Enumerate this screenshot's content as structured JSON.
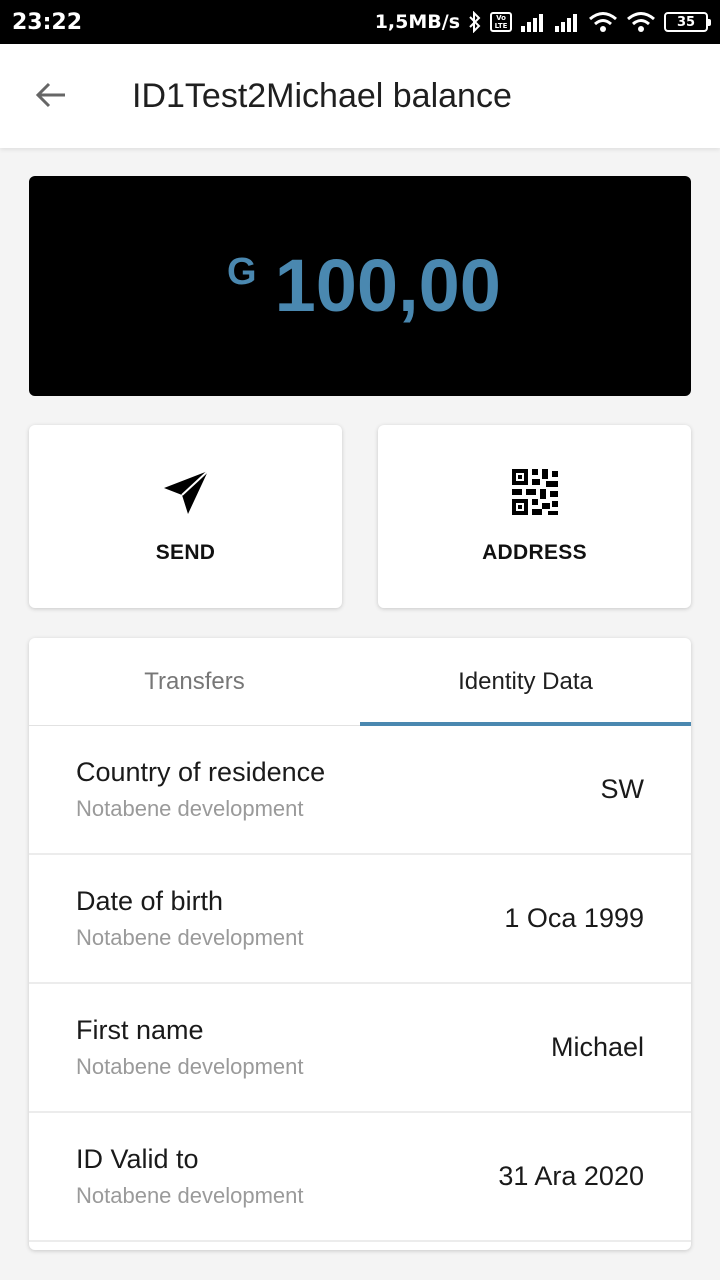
{
  "status_bar": {
    "time": "23:22",
    "speed": "1,5MB/s",
    "volte_top": "Vo",
    "volte_bottom": "LTE",
    "battery": "35"
  },
  "app_bar": {
    "title": "ID1Test2Michael balance",
    "back_icon": "arrow-left-icon"
  },
  "balance": {
    "currency_symbol": "G",
    "amount": "100,00",
    "amount_color": "#4a88b0"
  },
  "actions": {
    "send_label": "SEND",
    "send_icon": "send-icon",
    "address_label": "ADDRESS",
    "address_icon": "qr-code-icon"
  },
  "tabs": [
    {
      "label": "Transfers",
      "active": false
    },
    {
      "label": "Identity Data",
      "active": true
    }
  ],
  "identity_rows": [
    {
      "title": "Country of residence",
      "subtitle": "Notabene development",
      "value": "SW"
    },
    {
      "title": "Date of birth",
      "subtitle": "Notabene development",
      "value": "1 Oca 1999"
    },
    {
      "title": "First name",
      "subtitle": "Notabene development",
      "value": "Michael"
    },
    {
      "title": "ID Valid to",
      "subtitle": "Notabene development",
      "value": "31 Ara 2020"
    }
  ],
  "colors": {
    "accent": "#4a88b0",
    "status_bar": "#000000",
    "balance_card": "#000000"
  }
}
